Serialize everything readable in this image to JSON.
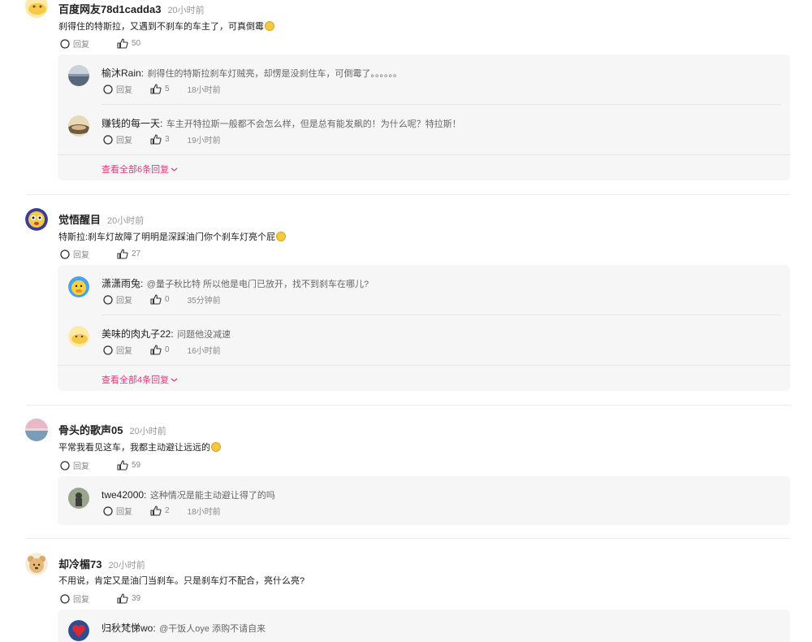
{
  "labels": {
    "reply": "回复"
  },
  "comments": [
    {
      "user": "百度网友78d1cadda3",
      "time": "20小时前",
      "text": "刹得住的特斯拉，又遇到不刹车的车主了，可真倒霉",
      "likes": "50",
      "replies": [
        {
          "user": "榆沐Rain:",
          "text": "刹得住的特斯拉刹车灯贼亮，却愣是没刹住车，可倒霉了。。。。。。",
          "likes": "5",
          "time": "18小时前"
        },
        {
          "user": "赚钱的每一天:",
          "text": "车主开特拉斯一般都不会怎么样，但是总有能发飙的！为什么呢？特拉斯！",
          "likes": "3",
          "time": "19小时前"
        }
      ],
      "view_all": "查看全部6条回复"
    },
    {
      "user": "觉悟醒目",
      "time": "20小时前",
      "text": "特斯拉:刹车灯故障了明明是深踩油门你个刹车灯亮个屁",
      "likes": "27",
      "replies": [
        {
          "user": "潇潇雨兔:",
          "text": "@量子秋比特 所以他是电门已放开，找不到刹车在哪儿?",
          "likes": "0",
          "time": "35分钟前"
        },
        {
          "user": "美味的肉丸子22:",
          "text": "问题他没减速",
          "likes": "0",
          "time": "16小时前"
        }
      ],
      "view_all": "查看全部4条回复"
    },
    {
      "user": "骨头的歌声05",
      "time": "20小时前",
      "text": "平常我看见这车，我都主动避让远远的",
      "likes": "59",
      "replies": [
        {
          "user": "twe42000:",
          "text": "这种情况是能主动避让得了的吗",
          "likes": "2",
          "time": "18小时前"
        }
      ]
    },
    {
      "user": "却冷楣73",
      "time": "20小时前",
      "text": "不用说，肯定又是油门当刹车。只是刹车灯不配合，亮什么亮?",
      "likes": "39",
      "replies": [
        {
          "user": "归秋梵悌wo:",
          "text": "@干饭人oye 添购不请自来"
        }
      ]
    }
  ]
}
